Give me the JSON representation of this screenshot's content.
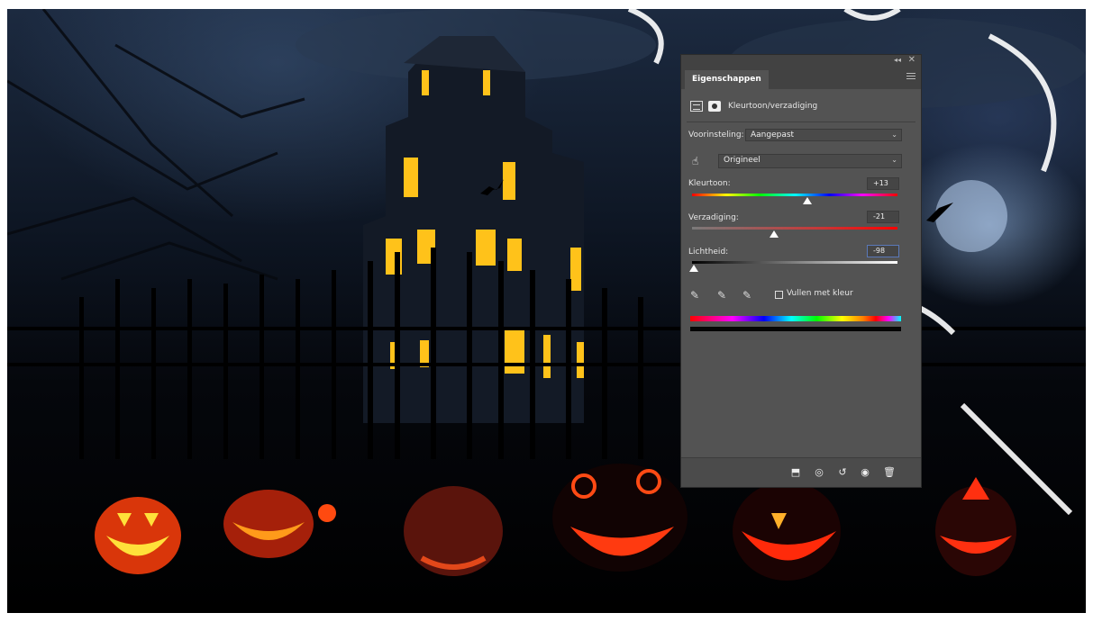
{
  "panel": {
    "tab_label": "Eigenschappen",
    "collapse_icon": "double-chevron-left-icon",
    "close_icon": "close-icon",
    "menu_icon": "panel-menu-icon",
    "adjustment_title": "Kleurtoon/verzadiging",
    "preset_label": "Voorinsteling:",
    "preset_value": "Aangepast",
    "channel_value": "Origineel",
    "hue_label": "Kleurtoon:",
    "hue_value": "+13",
    "saturation_label": "Verzadiging:",
    "saturation_value": "-21",
    "lightness_label": "Lichtheid:",
    "lightness_value": "-98",
    "colorize_label": "Vullen met kleur",
    "colorize_checked": false,
    "slider_positions": {
      "hue": 0.56,
      "saturation": 0.4,
      "lightness": 0.01
    },
    "footer_icons": [
      "clip-to-layer-icon",
      "view-previous-state-icon",
      "reset-icon",
      "visibility-eye-icon",
      "trash-icon"
    ]
  }
}
